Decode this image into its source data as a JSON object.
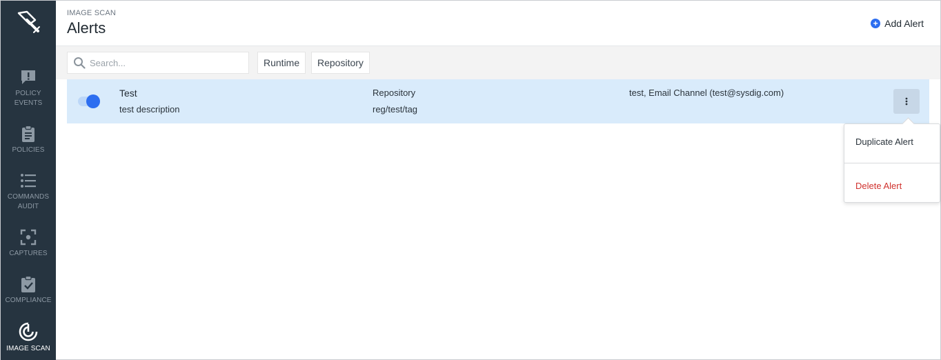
{
  "sidebar": {
    "items": [
      {
        "label_line1": "POLICY",
        "label_line2": "EVENTS",
        "icon": "chat-alert-icon"
      },
      {
        "label_line1": "POLICIES",
        "label_line2": "",
        "icon": "clipboard-list-icon"
      },
      {
        "label_line1": "COMMANDS",
        "label_line2": "AUDIT",
        "icon": "list-icon"
      },
      {
        "label_line1": "CAPTURES",
        "label_line2": "",
        "icon": "capture-focus-icon"
      },
      {
        "label_line1": "COMPLIANCE",
        "label_line2": "",
        "icon": "clipboard-check-icon"
      },
      {
        "label_line1": "IMAGE SCAN",
        "label_line2": "",
        "icon": "target-scan-icon"
      }
    ]
  },
  "header": {
    "overline": "IMAGE SCAN",
    "title": "Alerts",
    "add_label": "Add Alert"
  },
  "toolbar": {
    "search_placeholder": "Search...",
    "filter_runtime": "Runtime",
    "filter_repository": "Repository"
  },
  "alerts": [
    {
      "enabled": true,
      "name": "Test",
      "description": "test description",
      "type": "Repository",
      "scope": "reg/test/tag",
      "channels": "test, Email Channel (test@sysdig.com)"
    }
  ],
  "menu": {
    "duplicate": "Duplicate Alert",
    "delete": "Delete Alert"
  },
  "colors": {
    "sidebar_bg": "#263440",
    "accent": "#2d6ef0",
    "selected_row": "#d9ebfb",
    "danger": "#d0312d"
  }
}
